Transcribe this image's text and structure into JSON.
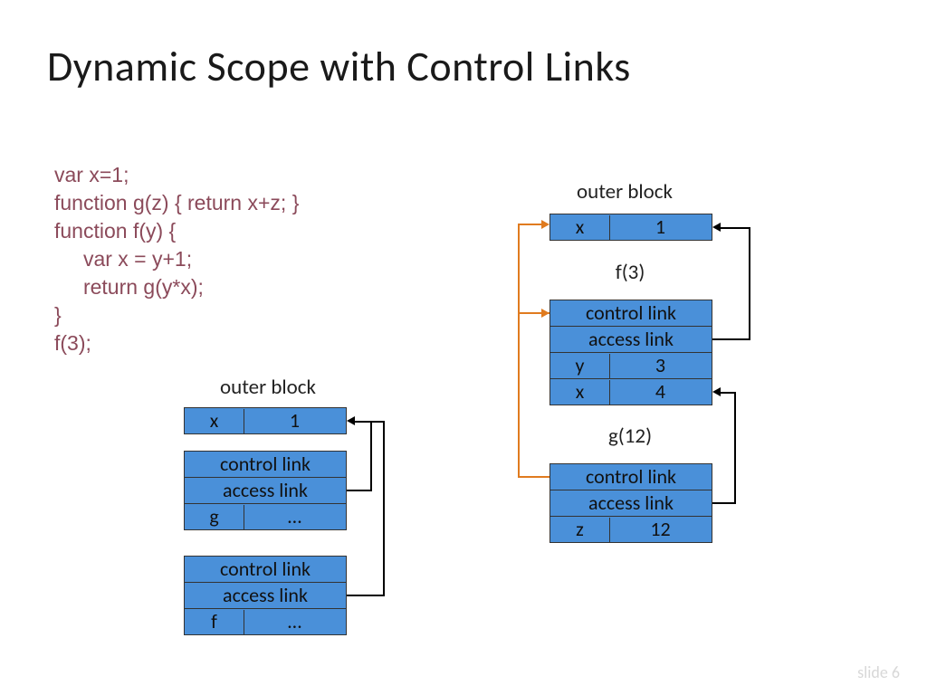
{
  "title": "Dynamic Scope with Control Links",
  "code": {
    "l1": "var x=1;",
    "l2": "function g(z) { return x+z; }",
    "l3": "function f(y) {",
    "l4": "     var x = y+1;",
    "l5": "     return g(y*x);",
    "l6": "}",
    "l7": "f(3);"
  },
  "left": {
    "label": "outer block",
    "r0": {
      "k": "x",
      "v": "1"
    },
    "t1": {
      "r0": "control link",
      "r1": "access link",
      "k": "g",
      "v": "…"
    },
    "t2": {
      "r0": "control link",
      "r1": "access link",
      "k": "f",
      "v": "…"
    }
  },
  "right": {
    "label0": "outer block",
    "r0": {
      "k": "x",
      "v": "1"
    },
    "label1": "f(3)",
    "t1": {
      "r0": "control link",
      "r1": "access link",
      "k0": "y",
      "v0": "3",
      "k1": "x",
      "v1": "4"
    },
    "label2": "g(12)",
    "t2": {
      "r0": "control link",
      "r1": "access link",
      "k": "z",
      "v": "12"
    }
  },
  "footer": "slide 6"
}
